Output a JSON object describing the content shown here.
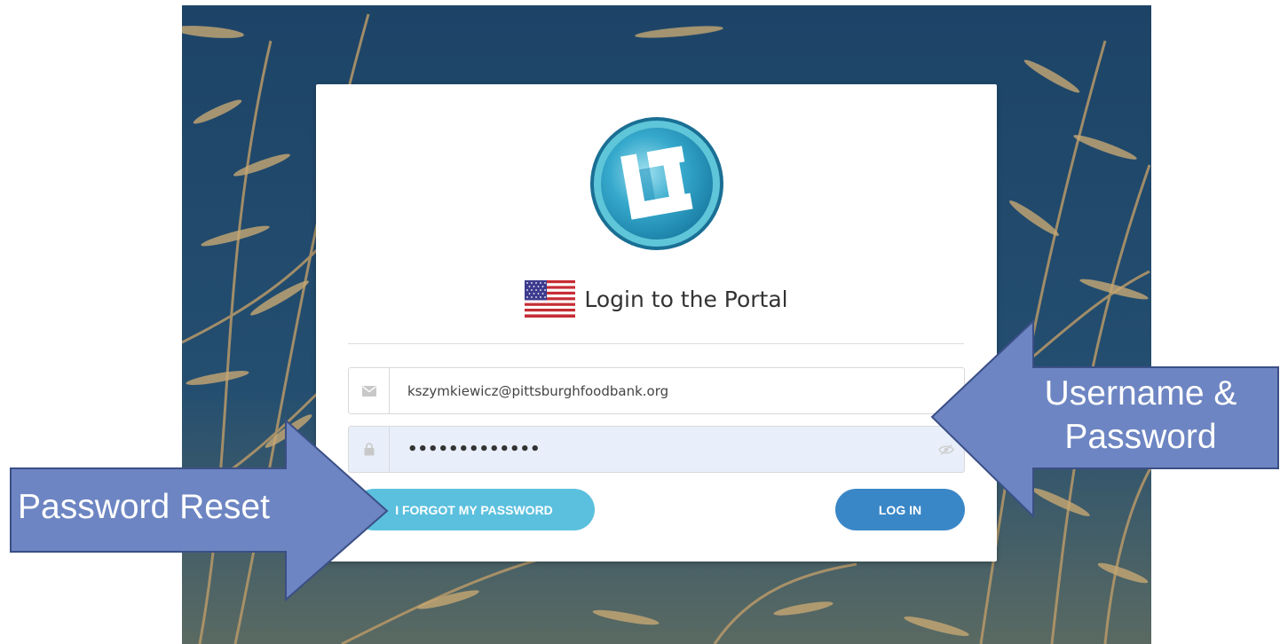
{
  "login": {
    "title": "Login to the Portal",
    "email_value": "kszymkiewicz@pittsburghfoodbank.org",
    "password_masked": "•••••••••••••",
    "forgot_button": "I FORGOT MY PASSWORD",
    "login_button": "LOG IN",
    "icons": {
      "email": "envelope-icon",
      "password": "lock-icon",
      "reveal": "eye-slash-icon",
      "language": "us-flag-icon",
      "logo": "portal-logo"
    }
  },
  "annotations": {
    "password_reset": "Password Reset",
    "username_password_line1": "Username &",
    "username_password_line2": "Password"
  },
  "colors": {
    "forgot_button": "#5bc0de",
    "login_button": "#3a87c7",
    "arrow_fill": "#6d85c2",
    "arrow_border": "#3b4f86",
    "password_field_bg": "#e8effb"
  }
}
